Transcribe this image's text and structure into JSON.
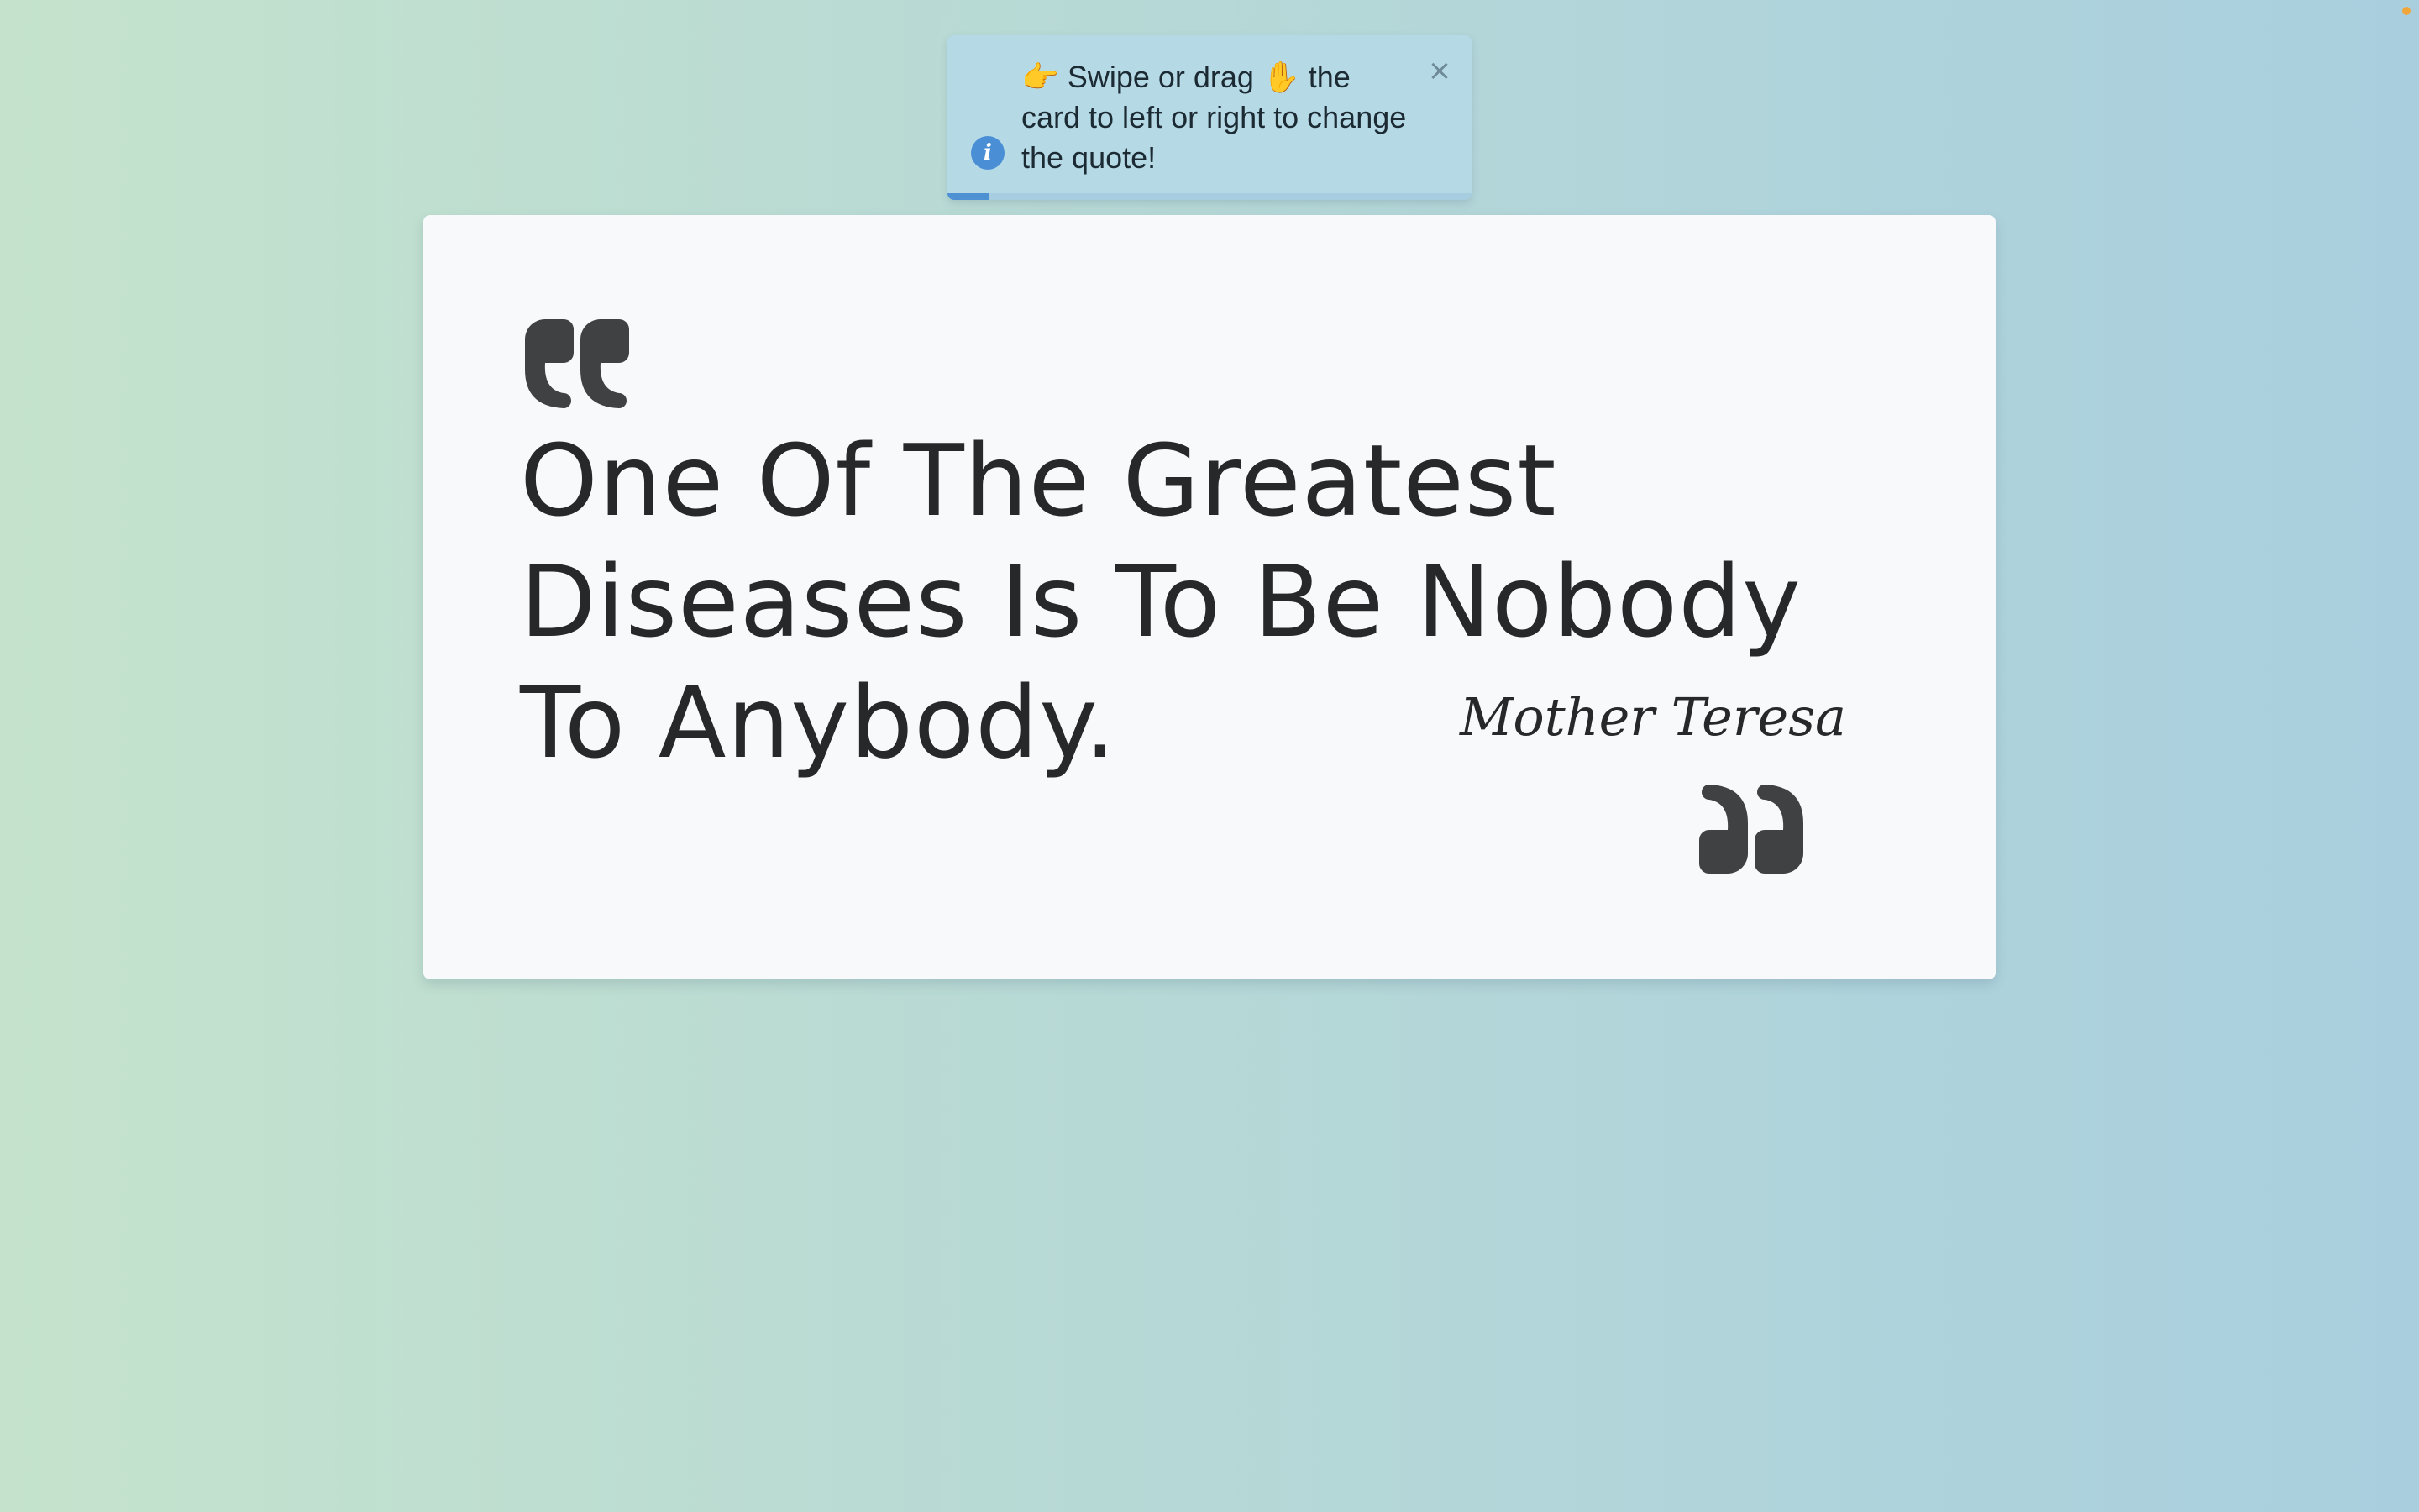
{
  "toast": {
    "message": "👉 Swipe or drag ✋ the card to left or right to change the quote!",
    "close_symbol": "×",
    "info_symbol": "i",
    "icon": "info-icon",
    "progress": 0.08,
    "accent_color": "#4e91d2",
    "background_color": "#b5dae6"
  },
  "quote": {
    "text": "One Of The Greatest Diseases Is To Be Nobody To Anybody.",
    "author": "Mother Teresa",
    "open_icon": "opening-quote-icon",
    "close_icon": "closing-quote-icon",
    "text_color": "#26282a",
    "card_color": "#f7f9fb"
  },
  "background": {
    "gradient_start": "#c5e3cc",
    "gradient_end": "#a9cfdf"
  },
  "indicator": {
    "color": "#f0a63a"
  }
}
